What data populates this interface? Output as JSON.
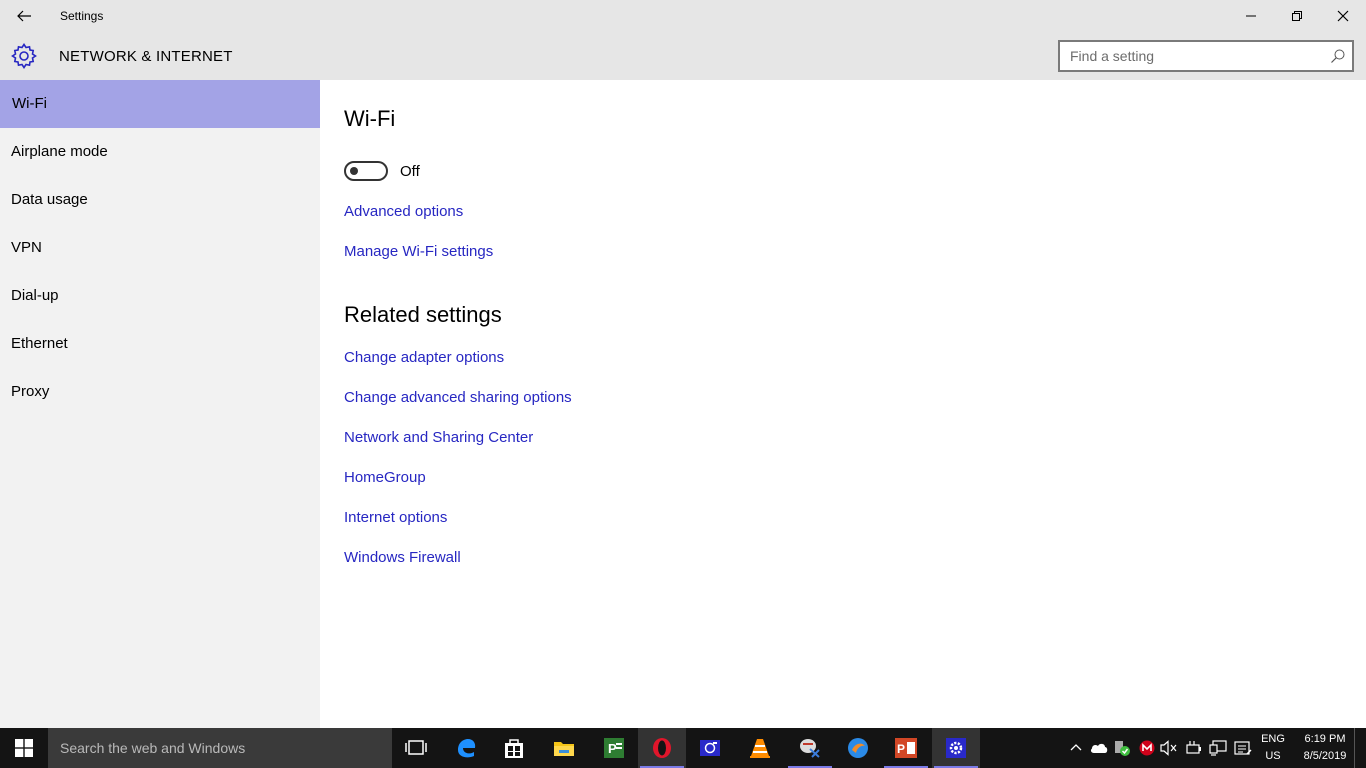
{
  "window": {
    "title": "Settings",
    "section": "NETWORK & INTERNET",
    "search_placeholder": "Find a setting"
  },
  "sidebar": {
    "items": [
      {
        "label": "Wi-Fi",
        "active": true
      },
      {
        "label": "Airplane mode"
      },
      {
        "label": "Data usage"
      },
      {
        "label": "VPN"
      },
      {
        "label": "Dial-up"
      },
      {
        "label": "Ethernet"
      },
      {
        "label": "Proxy"
      }
    ]
  },
  "main": {
    "heading": "Wi-Fi",
    "toggle_state": "Off",
    "links": [
      "Advanced options",
      "Manage Wi-Fi settings"
    ],
    "related_heading": "Related settings",
    "related_links": [
      "Change adapter options",
      "Change advanced sharing options",
      "Network and Sharing Center",
      "HomeGroup",
      "Internet options",
      "Windows Firewall"
    ]
  },
  "taskbar": {
    "search_placeholder": "Search the web and Windows",
    "apps": [
      "task-view-icon",
      "edge-icon",
      "store-icon",
      "file-explorer-icon",
      "project-icon",
      "opera-icon",
      "camera-app-icon",
      "vlc-icon",
      "media-player-icon",
      "browser-icon",
      "powerpoint-icon",
      "settings-icon"
    ],
    "language": "ENG",
    "region": "US",
    "time": "6:19 PM",
    "date": "8/5/2019"
  },
  "colors": {
    "accent": "#a3a3e6",
    "link": "#2727c2",
    "chrome": "#e6e6e6",
    "sidebar": "#f2f2f2",
    "taskbar": "#141414"
  }
}
